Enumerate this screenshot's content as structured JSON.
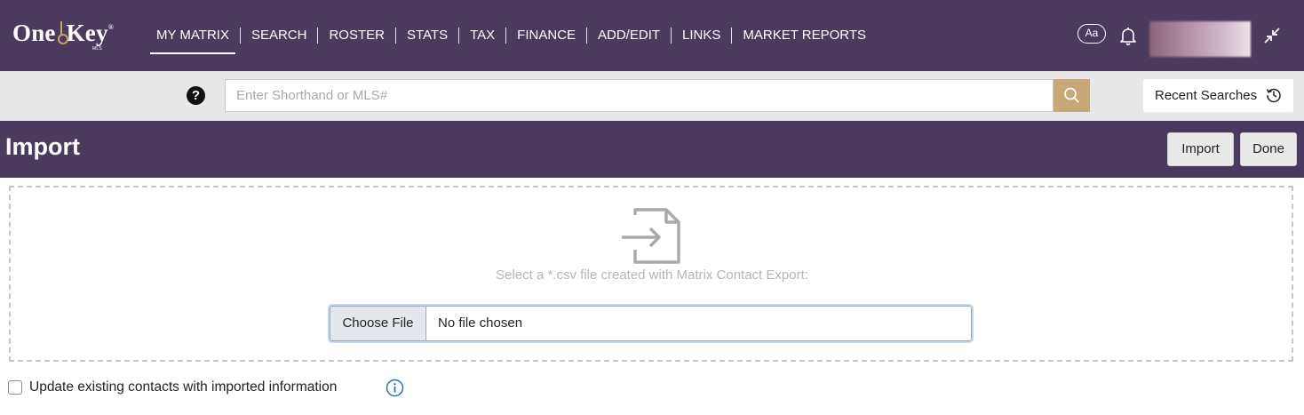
{
  "brand": {
    "name_part1": "One",
    "name_part2": "Key",
    "registered": "®",
    "sub": "MLS",
    "logo_icon": "key-icon"
  },
  "nav": {
    "items": [
      {
        "label": "MY MATRIX",
        "active": true
      },
      {
        "label": "SEARCH"
      },
      {
        "label": "ROSTER"
      },
      {
        "label": "STATS"
      },
      {
        "label": "TAX"
      },
      {
        "label": "FINANCE"
      },
      {
        "label": "ADD/EDIT"
      },
      {
        "label": "LINKS"
      },
      {
        "label": "MARKET REPORTS"
      }
    ],
    "text_size_label": "Aa",
    "icons": [
      "bell-icon",
      "avatar",
      "collapse-icon"
    ]
  },
  "search": {
    "placeholder": "Enter Shorthand or MLS#",
    "value": "",
    "help_label": "?",
    "recent_label": "Recent Searches",
    "icons": [
      "help-icon",
      "search-icon",
      "history-icon"
    ]
  },
  "page": {
    "title": "Import",
    "import_label": "Import",
    "done_label": "Done"
  },
  "dropzone": {
    "instruction": "Select a *.csv file created with Matrix Contact Export:",
    "choose_label": "Choose File",
    "file_status": "No file chosen",
    "icon": "file-import-icon"
  },
  "options": {
    "update_label": "Update existing contacts with imported information",
    "update_checked": false,
    "info_icon": "info-icon"
  },
  "colors": {
    "header_bg": "#4a3a5e",
    "searchbar_bg": "#e8e8e8",
    "search_button": "#c8a778",
    "logo_accent": "#c9a46a",
    "info_blue": "#2a6fb0"
  }
}
